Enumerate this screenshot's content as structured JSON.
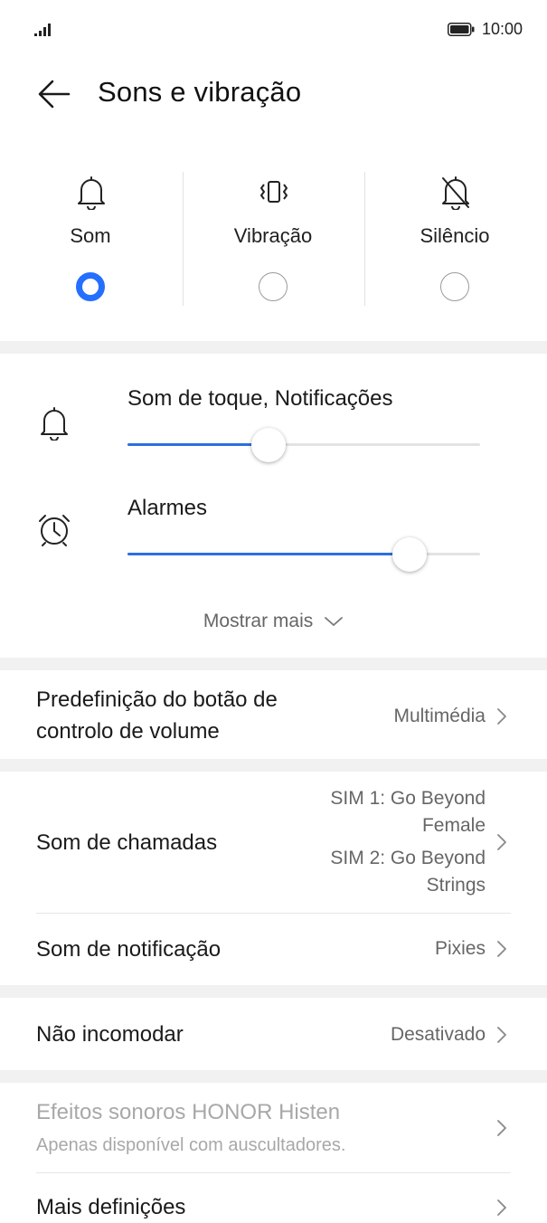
{
  "status_bar": {
    "time": "10:00"
  },
  "header": {
    "title": "Sons e vibração"
  },
  "modes": [
    {
      "label": "Som",
      "selected": true,
      "icon": "bell-icon"
    },
    {
      "label": "Vibração",
      "selected": false,
      "icon": "vibrate-icon"
    },
    {
      "label": "Silêncio",
      "selected": false,
      "icon": "bell-off-icon"
    }
  ],
  "volumes": [
    {
      "label": "Som de toque, Notificações",
      "level": 0.4,
      "icon": "bell-icon"
    },
    {
      "label": "Alarmes",
      "level": 0.8,
      "icon": "alarm-clock-icon"
    }
  ],
  "show_more": "Mostrar mais",
  "settings": {
    "volume_button": {
      "title_line1": "Predefinição do botão de",
      "title_line2": "controlo de volume",
      "value": "Multimédia"
    },
    "ringtone": {
      "title": "Som de chamadas",
      "sim1_line1": "SIM 1: Go Beyond",
      "sim1_line2": "Female",
      "sim2_line1": "SIM 2: Go Beyond",
      "sim2_line2": "Strings"
    },
    "notification_sound": {
      "title": "Som de notificação",
      "value": "Pixies"
    },
    "do_not_disturb": {
      "title": "Não incomodar",
      "value": "Desativado"
    },
    "histen": {
      "title": "Efeitos sonoros HONOR Histen",
      "subtitle": "Apenas disponível com auscultadores."
    },
    "more_settings": {
      "title": "Mais definições"
    }
  },
  "colors": {
    "accent": "#256fff",
    "slider_fill": "#2c6fe0",
    "section_gap": "#f1f1f1"
  }
}
